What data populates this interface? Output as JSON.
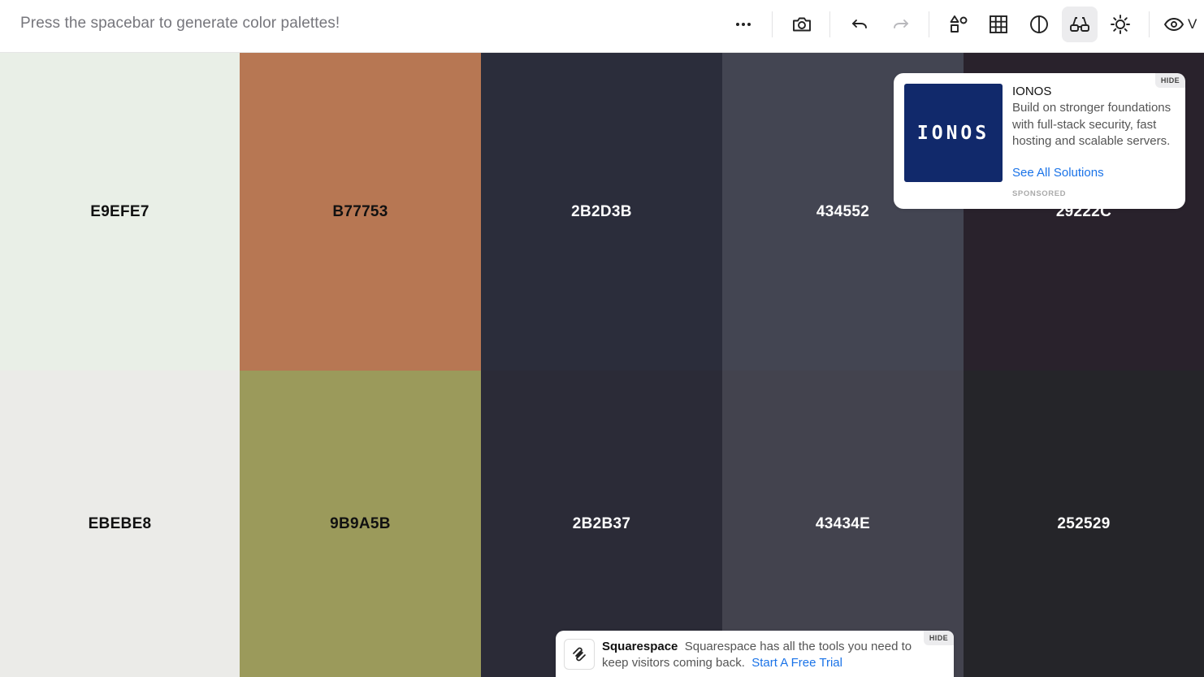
{
  "toolbar": {
    "hint": "Press the spacebar to generate color palettes!",
    "buttons": [
      {
        "name": "more-options",
        "icon": "more-dots-icon"
      },
      {
        "name": "screenshot",
        "icon": "camera-icon"
      },
      {
        "name": "undo",
        "icon": "undo-icon"
      },
      {
        "name": "redo",
        "icon": "redo-icon"
      },
      {
        "name": "shapes",
        "icon": "shapes-icon"
      },
      {
        "name": "grid-view",
        "icon": "grid-icon"
      },
      {
        "name": "contrast",
        "icon": "contrast-icon"
      },
      {
        "name": "color-blindness",
        "icon": "glasses-icon",
        "active": true
      },
      {
        "name": "brightness",
        "icon": "sun-icon"
      },
      {
        "name": "view",
        "icon": "eye-icon",
        "label": "V"
      }
    ]
  },
  "palette": {
    "rows": [
      [
        {
          "hex": "E9EFE7",
          "color": "#E9EFE7",
          "text": "dark"
        },
        {
          "hex": "B77753",
          "color": "#B77753",
          "text": "dark"
        },
        {
          "hex": "2B2D3B",
          "color": "#2B2D3B",
          "text": "light"
        },
        {
          "hex": "434552",
          "color": "#434552",
          "text": "light"
        },
        {
          "hex": "29222C",
          "color": "#29222C",
          "text": "light"
        }
      ],
      [
        {
          "hex": "EBEBE8",
          "color": "#EBEBE8",
          "text": "dark"
        },
        {
          "hex": "9B9A5B",
          "color": "#9B9A5B",
          "text": "dark"
        },
        {
          "hex": "2B2B37",
          "color": "#2B2B37",
          "text": "light"
        },
        {
          "hex": "43434E",
          "color": "#43434E",
          "text": "light"
        },
        {
          "hex": "252529",
          "color": "#252529",
          "text": "light"
        }
      ]
    ]
  },
  "ad_ionos": {
    "logo_text": "IONOS",
    "title": "IONOS",
    "body": "Build on stronger foundations with full-stack security, fast hosting and scalable servers.",
    "link": "See All Solutions",
    "sponsored": "SPONSORED",
    "hide": "HIDE",
    "logo_color": "#11296B"
  },
  "ad_squarespace": {
    "brand": "Squarespace",
    "body": "Squarespace has all the tools you need to keep visitors coming back.",
    "link": "Start A Free Trial",
    "hide": "HIDE"
  }
}
